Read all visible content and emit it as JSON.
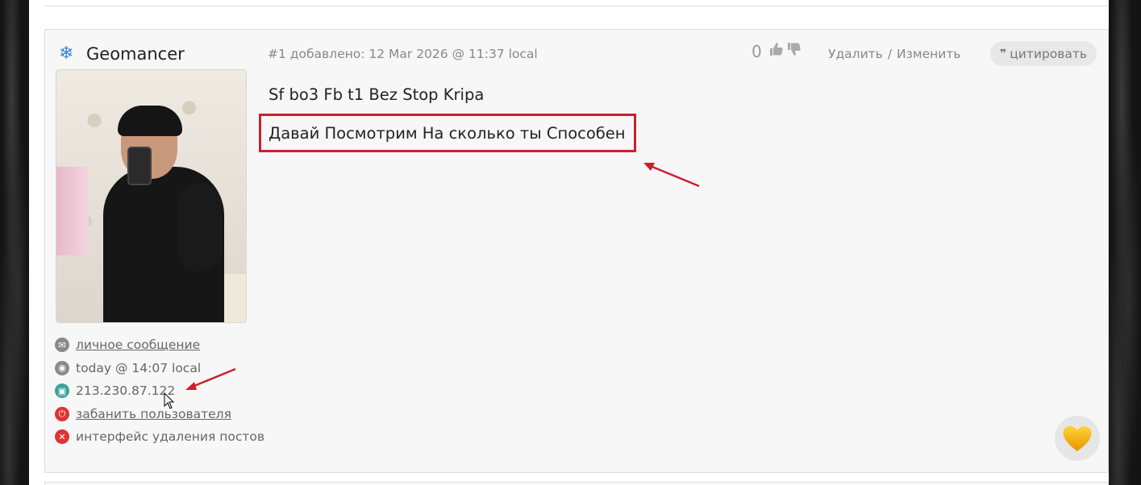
{
  "post": {
    "username": "Geomancer",
    "user_icon": "snowflake-icon",
    "meta": "#1 добавлено: 12 Mar 2026 @ 11:37 local",
    "vote_count": "0",
    "actions": {
      "delete": "Удалить",
      "separator": "/",
      "edit": "Изменить"
    },
    "quote_label": "цитировать",
    "lines": [
      "Sf bo3 Fb t1 Bez Stop Kripa",
      "Давай Посмотрим На сколько ты Способен"
    ]
  },
  "user_links": [
    {
      "label": "личное сообщение",
      "icon": "mail-icon"
    },
    {
      "label": "today @ 14:07 local",
      "icon": "clock-icon"
    },
    {
      "label": "213.230.87.122",
      "icon": "ip-icon"
    },
    {
      "label": "забанить пользователя",
      "icon": "ban-icon"
    },
    {
      "label": "интерфейс удаления постов",
      "icon": "delete-posts-icon"
    }
  ],
  "colors": {
    "annotation": "#cc1f2d",
    "heart": "#f2a900"
  }
}
